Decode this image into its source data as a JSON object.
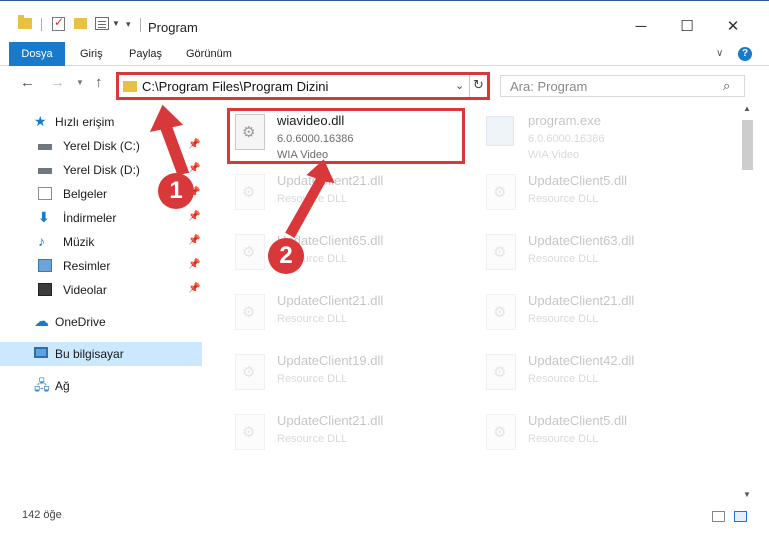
{
  "window": {
    "title": "Program",
    "minimize": "─",
    "maximize": "☐",
    "close": "✕"
  },
  "ribbon": {
    "tabs": [
      "Dosya",
      "Giriş",
      "Paylaş",
      "Görünüm"
    ],
    "help": "?"
  },
  "address": {
    "path": "C:\\Program Files\\Program Dizini",
    "search_placeholder": "Ara: Program"
  },
  "sidebar": {
    "items": [
      {
        "label": "Hızlı erişim"
      },
      {
        "label": "Yerel Disk (C:)"
      },
      {
        "label": "Yerel Disk (D:)"
      },
      {
        "label": "Belgeler"
      },
      {
        "label": "İndirmeler"
      },
      {
        "label": "Müzik"
      },
      {
        "label": "Resimler"
      },
      {
        "label": "Videolar"
      },
      {
        "label": "OneDrive"
      },
      {
        "label": "Bu bilgisayar"
      },
      {
        "label": "Ağ"
      }
    ]
  },
  "files": [
    {
      "name": "wiavideo.dll",
      "line1": "6.0.6000.16386",
      "line2": "WIA Video"
    },
    {
      "name": "program.exe",
      "line1": "6.0.6000.16386",
      "line2": "WIA Video"
    },
    {
      "name": "UpdateClient21.dll",
      "line1": "Resource DLL"
    },
    {
      "name": "UpdateClient5.dll",
      "line1": "Resource DLL"
    },
    {
      "name": "UpdateClient65.dll",
      "line1": "Resource DLL"
    },
    {
      "name": "UpdateClient63.dll",
      "line1": "Resource DLL"
    },
    {
      "name": "UpdateClient21.dll",
      "line1": "Resource DLL"
    },
    {
      "name": "UpdateClient21.dll",
      "line1": "Resource DLL"
    },
    {
      "name": "UpdateClient19.dll",
      "line1": "Resource DLL"
    },
    {
      "name": "UpdateClient42.dll",
      "line1": "Resource DLL"
    },
    {
      "name": "UpdateClient21.dll",
      "line1": "Resource DLL"
    },
    {
      "name": "UpdateClient5.dll",
      "line1": "Resource DLL"
    }
  ],
  "status": {
    "count": "142 öğe"
  },
  "callouts": [
    "1",
    "2"
  ],
  "colors": {
    "accent": "#1979ca",
    "highlight": "#d9383a"
  }
}
